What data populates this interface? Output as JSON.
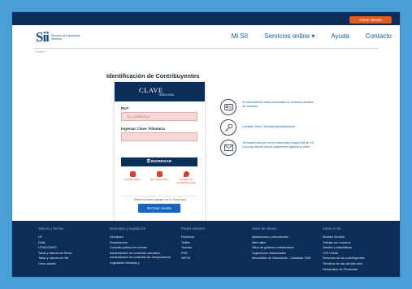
{
  "topbar": {
    "button_label": "Cerrar Sesión"
  },
  "header": {
    "logo_mark": "Sii",
    "logo_text": "Servicio de Impuestos Internos",
    "nav": [
      "Mi SII",
      "Servicios online ▾",
      "Ayuda",
      "Contacto"
    ]
  },
  "breadcrumb": "Home /",
  "page_title": "Identificación de Contribuyentes",
  "login": {
    "brand": "CLAVE",
    "brand_sub": "TRIBUTARIA",
    "rut_label": "RUT",
    "rut_placeholder": "Ej: 12345678-5",
    "password_label": "Ingresar Clave Tributaria",
    "submit_label": "INGRESAR",
    "options": [
      "Solicitar Clave",
      "Recuperar Clave",
      "Ingresar con Certificado Digital"
    ],
    "note": "También puedes ingresar con tu ClaveÚnica",
    "create_label": "Crear cuenta"
  },
  "info": [
    {
      "icon": "id-card-icon",
      "text": "Te solicitaremos datos personales en nuestros canales de contacto."
    },
    {
      "icon": "key-icon",
      "text": "Cambiar Clave Tributaria periódicamente."
    },
    {
      "icon": "mail-icon",
      "text": "Te enviaremos por correo electrónico ningún link de SII o acceso directo donde solicitemos ingresar tu clave."
    }
  ],
  "footer": {
    "columns": [
      {
        "title": "Valores y fechas",
        "items": [
          "UF",
          "Dólar",
          "UTM/UTA/IPC",
          "Tasas y valores de Renta",
          "Tasas y valores de IVA",
          "Otros valores"
        ]
      },
      {
        "title": "Normativa y legislación",
        "items": [
          "Circulares",
          "Resoluciones",
          "Consulta pública de normas",
          "Administrador de contenido normativo",
          "Administrador de contenido de Jurisprudencia",
          "Legislación tributaria y"
        ]
      },
      {
        "title": "Redes sociales",
        "items": [
          "Facebook",
          "Twitter",
          "Youtube",
          "RSS",
          "WIFI'S"
        ]
      },
      {
        "title": "Sitios de interés",
        "items": [
          "Aplicaciones y documentos",
          "Web útiles",
          "Sitios de gobierno relacionados",
          "Organismos relacionados",
          "Mercantiles de información - Contactar CMS"
        ]
      },
      {
        "title": "Sobre el SII",
        "items": [
          "Nuestro Servicio",
          "Trabaje con nosotros",
          "Gestión y estadísticas",
          "CFS Virtual",
          "Derechos de los contribuyentes",
          "Términos de uso del sitio web",
          "Declaración de Privacidad"
        ]
      }
    ]
  }
}
